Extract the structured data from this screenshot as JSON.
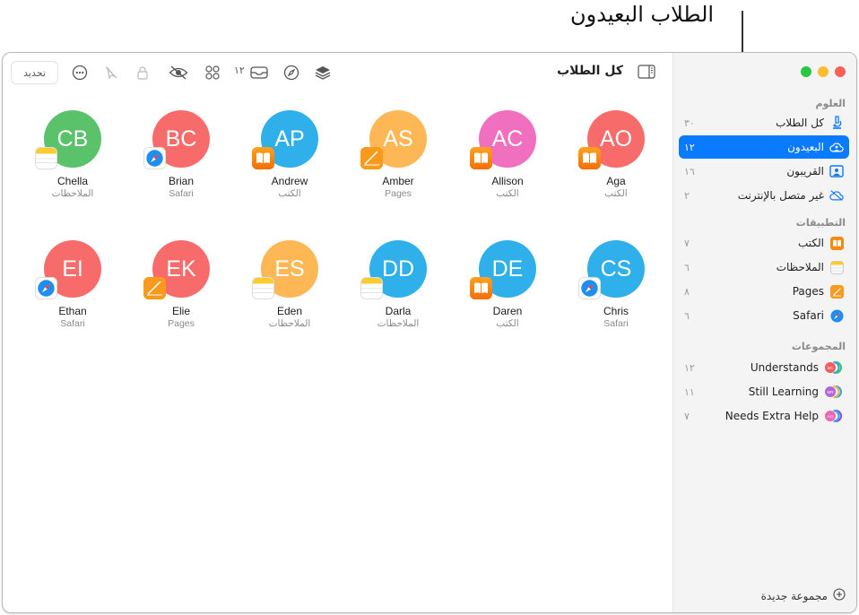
{
  "callout": {
    "label": "الطلاب البعيدون"
  },
  "toolbar": {
    "title": "كل الطلاب",
    "refresh_label": "تحديد",
    "inbox_count": "١٢",
    "icons": [
      "sidebar-toggle-icon",
      "layers-icon",
      "compass-icon",
      "inbox-icon",
      "apps-grid-icon",
      "eye-slash-icon",
      "lock-icon",
      "mute-pointer-icon",
      "more-icon"
    ]
  },
  "sidebar": {
    "sections": {
      "classes": "العلوم",
      "apps": "التطبيقات",
      "groups": "المجموعات"
    },
    "class_items": [
      {
        "label": "كل الطلاب",
        "count": "٣٠",
        "icon": "microscope-icon"
      },
      {
        "label": "البعيدون",
        "count": "١٢",
        "icon": "remote-cloud-icon",
        "active": true
      },
      {
        "label": "القريبون",
        "count": "١٦",
        "icon": "nearby-person-icon"
      },
      {
        "label": "غير متصل بالإنترنت",
        "count": "٢",
        "icon": "offline-cloud-icon"
      }
    ],
    "app_items": [
      {
        "label": "الكتب",
        "count": "٧",
        "icon": "books-app-icon"
      },
      {
        "label": "الملاحظات",
        "count": "٦",
        "icon": "notes-app-icon"
      },
      {
        "label": "Pages",
        "count": "٨",
        "icon": "pages-app-icon"
      },
      {
        "label": "Safari",
        "count": "٦",
        "icon": "safari-app-icon"
      }
    ],
    "group_items": [
      {
        "label": "Understands",
        "count": "١٢",
        "badge": "BC",
        "colors": [
          "#f25c5c",
          "#2aa9e8",
          "#34c759"
        ]
      },
      {
        "label": "Still Learning",
        "count": "١١",
        "badge": "MR",
        "colors": [
          "#b266d9",
          "#fbb03b",
          "#2aa9e8"
        ]
      },
      {
        "label": "Needs Extra Help",
        "count": "٧",
        "badge": "AO",
        "colors": [
          "#f264b4",
          "#2aa9e8",
          "#8a4cf0"
        ]
      }
    ],
    "new_group_label": "مجموعة جديدة"
  },
  "colors": {
    "accent": "#0a7aff",
    "green": "#5ac26a",
    "red": "#f76b6b",
    "blue": "#2fb0ea",
    "orange": "#fdb855",
    "pink": "#f06fbf"
  },
  "students": [
    {
      "initials": "AO",
      "name": "Aga",
      "app": "الكتب",
      "app_icon": "books",
      "color": "#f76b6b"
    },
    {
      "initials": "AC",
      "name": "Allison",
      "app": "الكتب",
      "app_icon": "books",
      "color": "#f06fbf"
    },
    {
      "initials": "AS",
      "name": "Amber",
      "app": "Pages",
      "app_icon": "pages",
      "color": "#fdb855"
    },
    {
      "initials": "AP",
      "name": "Andrew",
      "app": "الكتب",
      "app_icon": "books",
      "color": "#2fb0ea"
    },
    {
      "initials": "BC",
      "name": "Brian",
      "app": "Safari",
      "app_icon": "safari",
      "color": "#f76b6b"
    },
    {
      "initials": "CB",
      "name": "Chella",
      "app": "الملاحظات",
      "app_icon": "notes",
      "color": "#5ac26a"
    },
    {
      "initials": "CS",
      "name": "Chris",
      "app": "Safari",
      "app_icon": "safari",
      "color": "#2fb0ea"
    },
    {
      "initials": "DE",
      "name": "Daren",
      "app": "الكتب",
      "app_icon": "books",
      "color": "#2fb0ea"
    },
    {
      "initials": "DD",
      "name": "Darla",
      "app": "الملاحظات",
      "app_icon": "notes",
      "color": "#2fb0ea"
    },
    {
      "initials": "ES",
      "name": "Eden",
      "app": "الملاحظات",
      "app_icon": "notes",
      "color": "#fdb855"
    },
    {
      "initials": "EK",
      "name": "Elie",
      "app": "Pages",
      "app_icon": "pages",
      "color": "#f76b6b"
    },
    {
      "initials": "EI",
      "name": "Ethan",
      "app": "Safari",
      "app_icon": "safari",
      "color": "#f76b6b"
    }
  ]
}
